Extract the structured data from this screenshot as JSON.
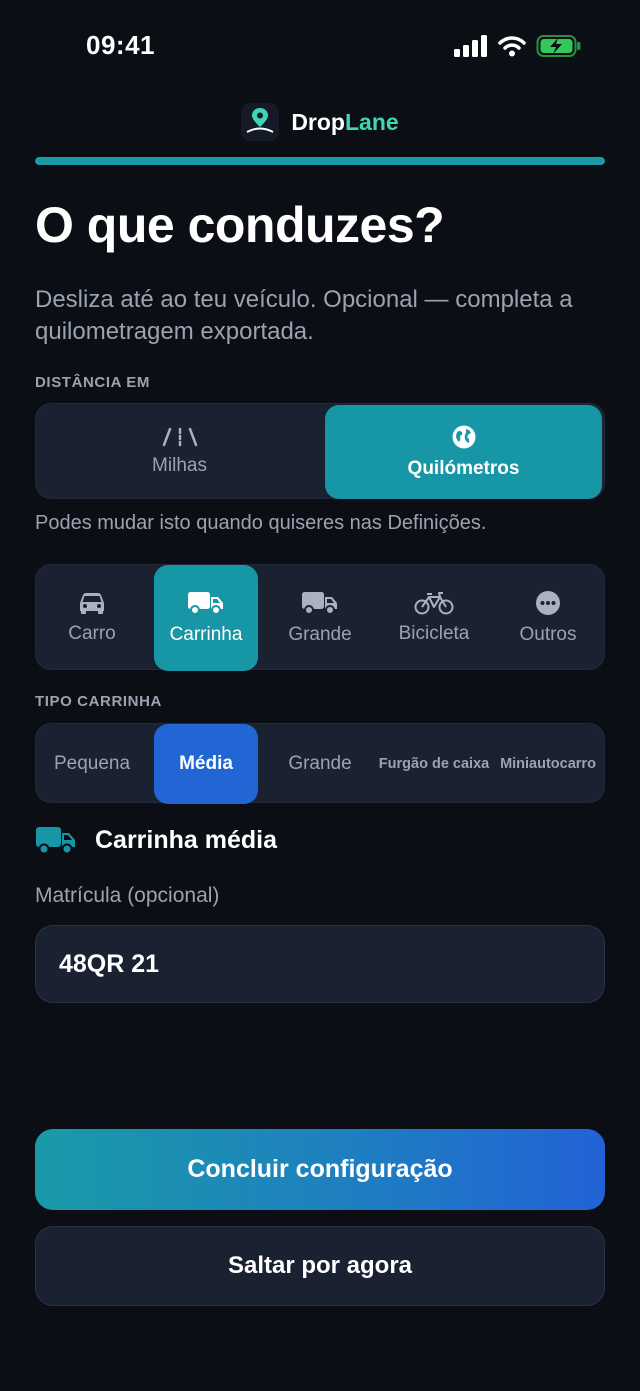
{
  "status_bar": {
    "time": "09:41"
  },
  "app": {
    "name_part1": "Drop",
    "name_part2": "Lane",
    "logo_text": "Drop Lane"
  },
  "progress": {
    "value": 1.0
  },
  "title": "O que conduzes?",
  "subtitle": "Desliza até ao teu veículo. Opcional — completa a quilometragem exportada.",
  "distance": {
    "label": "DISTÂNCIA EM",
    "options": [
      {
        "label": "Milhas",
        "icon": "road-icon",
        "selected": false
      },
      {
        "label": "Quilómetros",
        "icon": "globe-icon",
        "selected": true
      }
    ],
    "hint": "Podes mudar isto quando quiseres nas Definições."
  },
  "vehicles": [
    {
      "label": "Carro",
      "icon": "car-icon",
      "selected": false
    },
    {
      "label": "Carrinha",
      "icon": "van-icon",
      "selected": true
    },
    {
      "label": "Grande",
      "icon": "truck-icon",
      "selected": false
    },
    {
      "label": "Bicicleta",
      "icon": "bicycle-icon",
      "selected": false
    },
    {
      "label": "Outros",
      "icon": "more-icon",
      "selected": false
    }
  ],
  "van_type": {
    "label": "TIPO CARRINHA",
    "options": [
      {
        "label": "Pequena",
        "selected": false
      },
      {
        "label": "Média",
        "selected": true
      },
      {
        "label": "Grande",
        "selected": false
      },
      {
        "label": "Furgão de caixa",
        "selected": false
      },
      {
        "label": "Miniautocarro",
        "selected": false
      }
    ]
  },
  "selected_vehicle": {
    "label": "Carrinha média",
    "icon": "van-icon"
  },
  "plate": {
    "label": "Matrícula (opcional)",
    "value": "48QR 21"
  },
  "buttons": {
    "primary": "Concluir configuração",
    "secondary": "Saltar por agora"
  },
  "colors": {
    "accent_teal": "#1797a6",
    "accent_blue": "#2166d4",
    "brand_green": "#3fd6b5",
    "background": "#0b0e14",
    "surface": "#1a2130"
  }
}
